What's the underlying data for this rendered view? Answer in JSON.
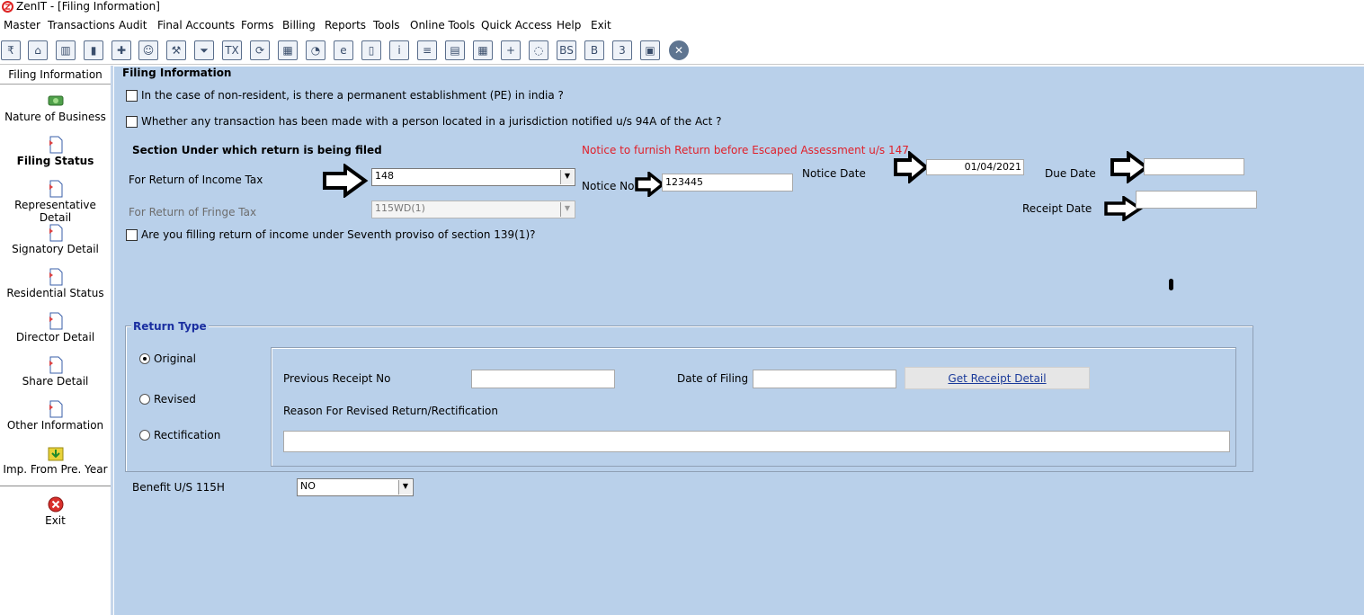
{
  "window": {
    "title": "ZenIT - [Filing Information]"
  },
  "menu": [
    "Master",
    "Transactions",
    "Audit",
    "Final Accounts",
    "Forms",
    "Billing",
    "Reports",
    "Tools",
    "Online Tools",
    "Quick Access",
    "Help",
    "Exit"
  ],
  "sidebar": {
    "header": "Filing Information",
    "items": [
      {
        "label": "Nature of Business",
        "icon": "money-icon"
      },
      {
        "label": "Filing Status",
        "icon": "document-icon",
        "active": true
      },
      {
        "label": "Representative Detail",
        "icon": "document-icon"
      },
      {
        "label": "Signatory Detail",
        "icon": "document-icon"
      },
      {
        "label": "Residential Status",
        "icon": "document-icon"
      },
      {
        "label": "Director Detail",
        "icon": "document-icon"
      },
      {
        "label": "Share Detail",
        "icon": "document-icon"
      },
      {
        "label": "Other Information",
        "icon": "document-icon"
      },
      {
        "label": "Imp. From Pre. Year",
        "icon": "import-folder-icon"
      }
    ],
    "exit": {
      "label": "Exit",
      "icon": "close-icon",
      "color": "#d9302c"
    }
  },
  "form": {
    "section_title": "Filing Information",
    "q_pe": "In the case of non-resident, is there a permanent establishment (PE) in india ?",
    "q_94a": "Whether any transaction has been made with a person located in a jurisdiction notified u/s 94A of the Act ?",
    "section_heading": "Section Under which return is being filed",
    "income_tax_label": "For Return of Income Tax",
    "income_tax_value": "148",
    "fringe_tax_label": "For Return of Fringe Tax",
    "fringe_tax_value": "115WD(1)",
    "notice_heading": "Notice to furnish Return before Escaped Assessment u/s 147",
    "notice_no_label": "Notice No.",
    "notice_no_value": "123445",
    "notice_date_label": "Notice Date",
    "notice_date_value": "01/04/2021",
    "due_date_label": "Due Date",
    "due_date_value": "",
    "receipt_date_label": "Receipt Date",
    "receipt_date_value": "",
    "q_seventh": "Are you filling return of income under Seventh proviso of section 139(1)?"
  },
  "return_type": {
    "title": "Return Type",
    "options": [
      {
        "label": "Original",
        "selected": true
      },
      {
        "label": "Revised",
        "selected": false
      },
      {
        "label": "Rectification",
        "selected": false
      }
    ],
    "prev_receipt_label": "Previous Receipt No",
    "prev_receipt_value": "",
    "date_filing_label": "Date of Filing",
    "date_filing_value": "",
    "get_receipt_label": "Get Receipt Detail",
    "reason_label": "Reason For Revised Return/Rectification",
    "reason_value": ""
  },
  "benefit": {
    "label": "Benefit U/S 115H",
    "value": "NO"
  },
  "colors": {
    "panel_bg": "#b9d0ea",
    "notice_red": "#e0202a",
    "title_blue": "#1a2ea0"
  }
}
